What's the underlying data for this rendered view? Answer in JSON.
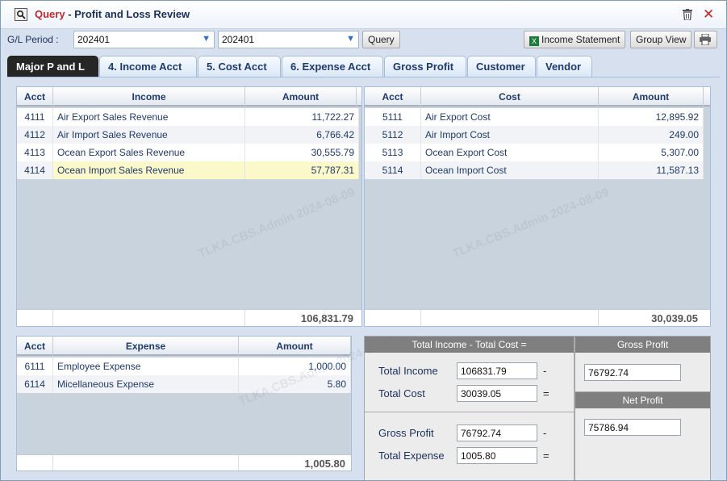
{
  "title": {
    "query_word": "Query",
    "separator": " - ",
    "text": "Profit and Loss Review"
  },
  "toolbar": {
    "period_label": "G/L Period :",
    "period_from": "202401",
    "period_to": "202401",
    "query_button": "Query",
    "income_statement_button": "Income Statement",
    "group_view_button": "Group View"
  },
  "tabs": [
    {
      "label": "Major P and L",
      "active": true
    },
    {
      "label": "4. Income Acct"
    },
    {
      "label": "5. Cost Acct"
    },
    {
      "label": "6. Expense Acct"
    },
    {
      "label": "Gross Profit"
    },
    {
      "label": "Customer"
    },
    {
      "label": "Vendor"
    }
  ],
  "income_grid": {
    "headers": [
      "Acct",
      "Income",
      "Amount"
    ],
    "rows": [
      {
        "acct": "4111",
        "name": "Air Export Sales Revenue",
        "amount": "11,722.27"
      },
      {
        "acct": "4112",
        "name": "Air Import Sales Revenue",
        "amount": "6,766.42"
      },
      {
        "acct": "4113",
        "name": "Ocean Export Sales Revenue",
        "amount": "30,555.79"
      },
      {
        "acct": "4114",
        "name": "Ocean Import Sales Revenue",
        "amount": "57,787.31",
        "selected": true
      }
    ],
    "total": "106,831.79"
  },
  "cost_grid": {
    "headers": [
      "Acct",
      "Cost",
      "Amount"
    ],
    "rows": [
      {
        "acct": "5111",
        "name": "Air Export Cost",
        "amount": "12,895.92"
      },
      {
        "acct": "5112",
        "name": "Air Import Cost",
        "amount": "249.00"
      },
      {
        "acct": "5113",
        "name": "Ocean Export Cost",
        "amount": "5,307.00"
      },
      {
        "acct": "5114",
        "name": "Ocean Import Cost",
        "amount": "11,587.13"
      }
    ],
    "total": "30,039.05"
  },
  "expense_grid": {
    "headers": [
      "Acct",
      "Expense",
      "Amount"
    ],
    "rows": [
      {
        "acct": "6111",
        "name": "Employee Expense",
        "amount": "1,000.00"
      },
      {
        "acct": "6114",
        "name": "Micellaneous Expense",
        "amount": "5.80"
      }
    ],
    "total": "1,005.80"
  },
  "calc": {
    "header": "Total Income - Total Cost =",
    "total_income_label": "Total Income",
    "total_income": "106831.79",
    "total_cost_label": "Total Cost",
    "total_cost": "30039.05",
    "gross_profit_label": "Gross Profit",
    "gross_profit": "76792.74",
    "total_expense_label": "Total Expense",
    "total_expense": "1005.80",
    "minus": "-",
    "equals": "="
  },
  "gross_profit_box": {
    "header": "Gross Profit",
    "value": "76792.74"
  },
  "net_profit_box": {
    "header": "Net Profit",
    "value": "75786.94"
  },
  "watermark": "TLKA.CBS.Admin 2024-08-09",
  "colors": {
    "title_query": "#c0282d",
    "active_tab": "#262626",
    "selected_row": "#fbf8c9",
    "close_icon": "#d21d1d"
  }
}
